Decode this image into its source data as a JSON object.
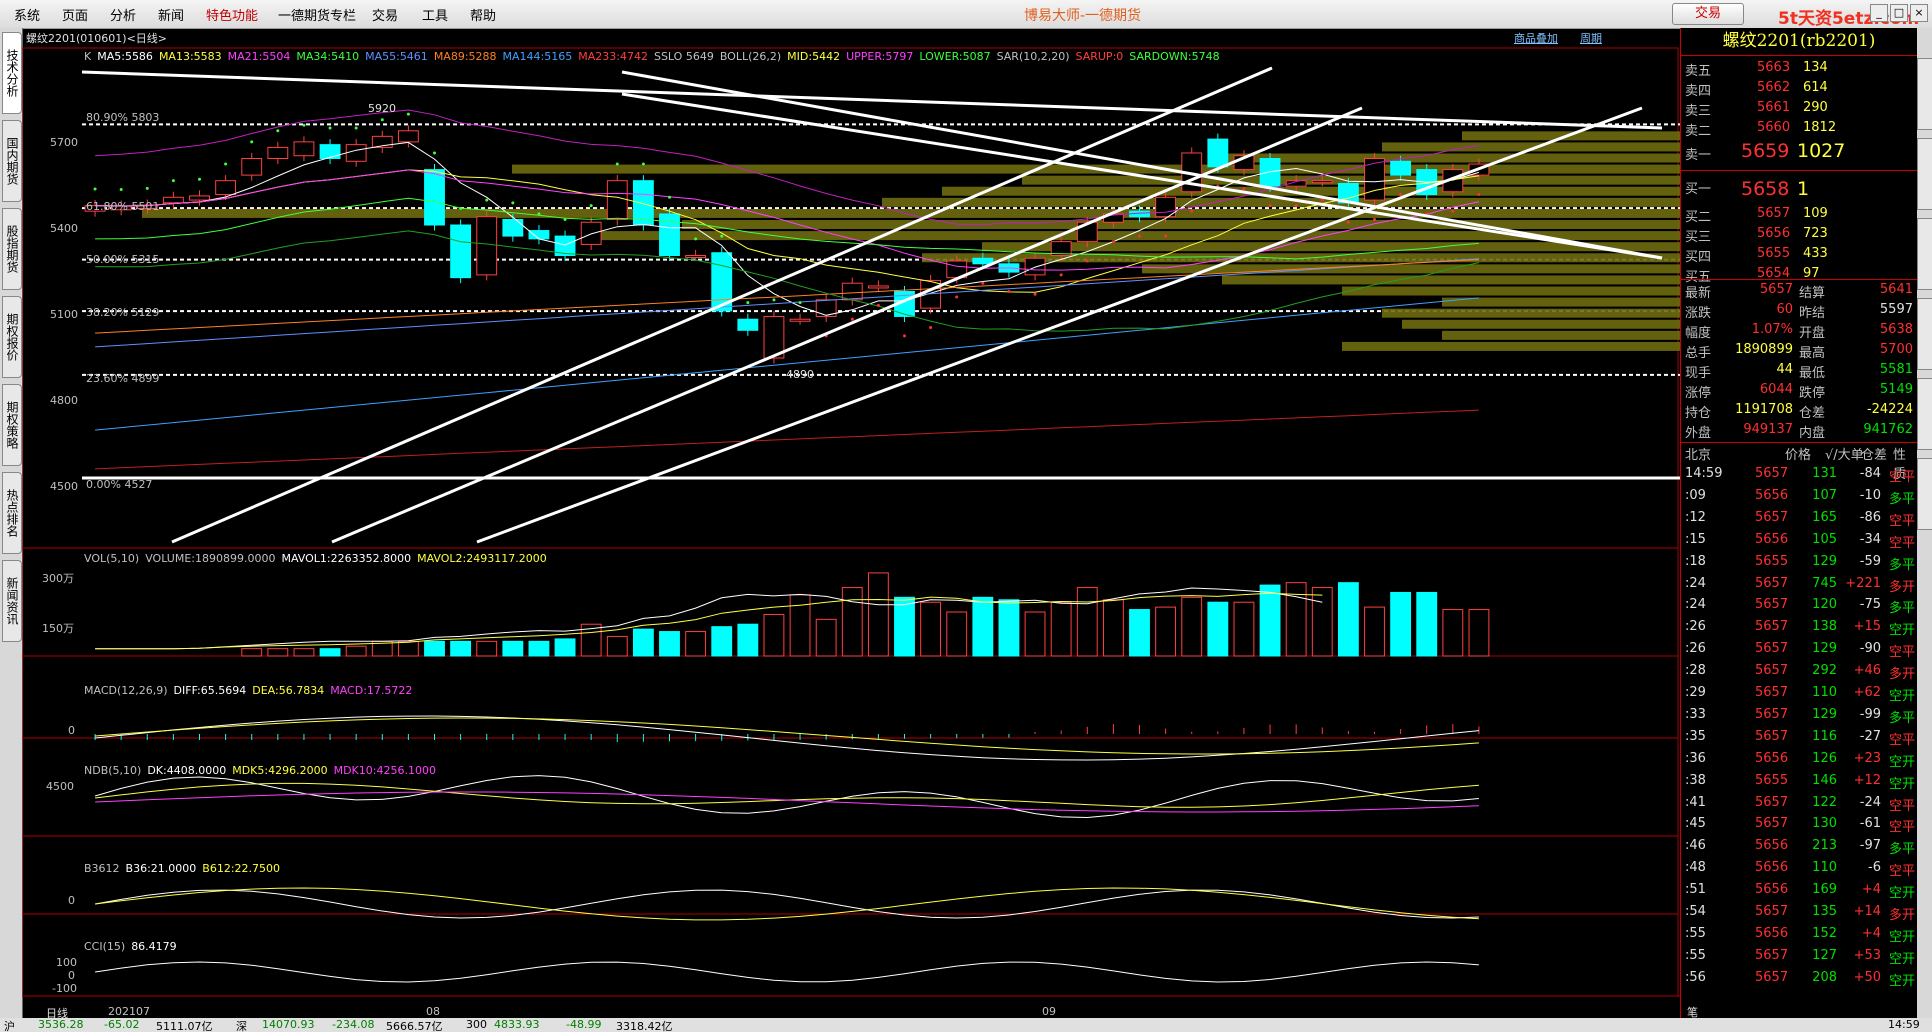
{
  "menu": {
    "items": [
      "系统",
      "页面",
      "分析",
      "新闻",
      "特色功能",
      "一德期货专栏",
      "交易",
      "工具",
      "帮助"
    ],
    "center_title": "博易大师-一德期货",
    "trade_button": "交易",
    "watermark": "5t天资5etz.com"
  },
  "left_tabs": [
    "技术分析",
    "国内期货",
    "股指期货",
    "期权报价",
    "期权策略",
    "热点排名",
    "新闻资讯"
  ],
  "chart_header": {
    "symbol": "螺纹2201(010601)<日线>",
    "links": [
      "商品叠加",
      "周期"
    ],
    "main_indicators": [
      {
        "text": "K",
        "color": "#c0c0c0"
      },
      {
        "text": "MA5:5586",
        "color": "#ffffff"
      },
      {
        "text": "MA13:5583",
        "color": "#ffff40"
      },
      {
        "text": "MA21:5504",
        "color": "#ff40ff"
      },
      {
        "text": "MA34:5410",
        "color": "#40ff40"
      },
      {
        "text": "MA55:5461",
        "color": "#6090ff"
      },
      {
        "text": "MA89:5288",
        "color": "#ff8020"
      },
      {
        "text": "MA144:5165",
        "color": "#40a0ff"
      },
      {
        "text": "MA233:4742",
        "color": "#ff4040"
      },
      {
        "text": "SSLO 5649",
        "color": "#c0c0c0"
      },
      {
        "text": "BOLL(26,2)",
        "color": "#c0c0c0"
      },
      {
        "text": "MID:5442",
        "color": "#ffff40"
      },
      {
        "text": "UPPER:5797",
        "color": "#ff40ff"
      },
      {
        "text": "LOWER:5087",
        "color": "#40ff40"
      },
      {
        "text": "SAR(10,2,20)",
        "color": "#c0c0c0"
      },
      {
        "text": "SARUP:0",
        "color": "#ff4040"
      },
      {
        "text": "SARDOWN:5748",
        "color": "#40ff40"
      }
    ]
  },
  "fib_levels": [
    {
      "label": "80.90% 5803"
    },
    {
      "label": "61.80% 5501"
    },
    {
      "label": "50.00% 5315"
    },
    {
      "label": "38.20% 5129"
    },
    {
      "label": "23.60% 4899"
    },
    {
      "label": "0.00% 4527"
    }
  ],
  "price_axis": [
    "5700",
    "5400",
    "5100",
    "4800",
    "4500"
  ],
  "price_marks": {
    "high": "5920",
    "low": "4890"
  },
  "vol_header": [
    {
      "text": "VOL(5,10)",
      "color": "#c0c0c0"
    },
    {
      "text": "VOLUME:1890899.0000",
      "color": "#c0c0c0"
    },
    {
      "text": "MAVOL1:2263352.8000",
      "color": "#ffffff"
    },
    {
      "text": "MAVOL2:2493117.2000",
      "color": "#ffff40"
    }
  ],
  "vol_axis": [
    "300万",
    "150万"
  ],
  "macd_header": [
    {
      "text": "MACD(12,26,9)",
      "color": "#c0c0c0"
    },
    {
      "text": "DIFF:65.5694",
      "color": "#ffffff"
    },
    {
      "text": "DEA:56.7834",
      "color": "#ffff40"
    },
    {
      "text": "MACD:17.5722",
      "color": "#ff40ff"
    }
  ],
  "macd_axis": [
    "0"
  ],
  "ndb_header": [
    {
      "text": "NDB(5,10)",
      "color": "#c0c0c0"
    },
    {
      "text": "DK:4408.0000",
      "color": "#ffffff"
    },
    {
      "text": "MDK5:4296.2000",
      "color": "#ffff40"
    },
    {
      "text": "MDK10:4256.1000",
      "color": "#ff40ff"
    }
  ],
  "ndb_axis": [
    "4500"
  ],
  "b3612_header": [
    {
      "text": "B3612",
      "color": "#c0c0c0"
    },
    {
      "text": "B36:21.0000",
      "color": "#ffffff"
    },
    {
      "text": "B612:22.7500",
      "color": "#ffff40"
    }
  ],
  "b3612_axis": [
    "0"
  ],
  "cci_header": [
    {
      "text": "CCI(15)",
      "color": "#c0c0c0"
    },
    {
      "text": "86.4179",
      "color": "#ffffff"
    }
  ],
  "cci_axis": [
    "100",
    "0",
    "-100"
  ],
  "time_axis": {
    "period_label": "日线",
    "labels": [
      "202107",
      "08",
      "09"
    ]
  },
  "quote": {
    "title": "螺纹2201(rb2201)",
    "asks": [
      {
        "label": "卖五",
        "price": "5663",
        "vol": "134"
      },
      {
        "label": "卖四",
        "price": "5662",
        "vol": "614"
      },
      {
        "label": "卖三",
        "price": "5661",
        "vol": "290"
      },
      {
        "label": "卖二",
        "price": "5660",
        "vol": "1812"
      },
      {
        "label": "卖一",
        "price": "5659",
        "vol": "1027"
      }
    ],
    "bids": [
      {
        "label": "买一",
        "price": "5658",
        "vol": "1"
      },
      {
        "label": "买二",
        "price": "5657",
        "vol": "109"
      },
      {
        "label": "买三",
        "price": "5656",
        "vol": "723"
      },
      {
        "label": "买四",
        "price": "5655",
        "vol": "433"
      },
      {
        "label": "买五",
        "price": "5654",
        "vol": "97"
      }
    ],
    "stats": [
      {
        "l1": "最新",
        "v1": "5657",
        "c1": "red",
        "l2": "结算",
        "v2": "5641",
        "c2": "red"
      },
      {
        "l1": "涨跌",
        "v1": "60",
        "c1": "red",
        "l2": "昨结",
        "v2": "5597",
        "c2": "white"
      },
      {
        "l1": "幅度",
        "v1": "1.07%",
        "c1": "red",
        "l2": "开盘",
        "v2": "5638",
        "c2": "red"
      },
      {
        "l1": "总手",
        "v1": "1890899",
        "c1": "yel",
        "l2": "最高",
        "v2": "5700",
        "c2": "red"
      },
      {
        "l1": "现手",
        "v1": "44",
        "c1": "yel",
        "l2": "最低",
        "v2": "5581",
        "c2": "green"
      },
      {
        "l1": "涨停",
        "v1": "6044",
        "c1": "red",
        "l2": "跌停",
        "v2": "5149",
        "c2": "green"
      },
      {
        "l1": "持仓",
        "v1": "1191708",
        "c1": "yel",
        "l2": "仓差",
        "v2": "-24224",
        "c2": "yel"
      },
      {
        "l1": "外盘",
        "v1": "949137",
        "c1": "red",
        "l2": "内盘",
        "v2": "941762",
        "c2": "green"
      }
    ],
    "tick_header": {
      "place": "北京",
      "price": "价格",
      "vol": "√/大单",
      "oi": "仓差",
      "nature": "性质"
    },
    "ticks": [
      {
        "t": "14:59",
        "p": "5657",
        "v": "131",
        "oi": "-84",
        "n": "空平",
        "nc": "red"
      },
      {
        "t": ":09",
        "p": "5656",
        "v": "107",
        "oi": "-10",
        "n": "多平",
        "nc": "green"
      },
      {
        "t": ":12",
        "p": "5657",
        "v": "165",
        "oi": "-86",
        "n": "空平",
        "nc": "red"
      },
      {
        "t": ":15",
        "p": "5656",
        "v": "105",
        "oi": "-34",
        "n": "空平",
        "nc": "red"
      },
      {
        "t": ":18",
        "p": "5655",
        "v": "129",
        "oi": "-59",
        "n": "多平",
        "nc": "green"
      },
      {
        "t": ":24",
        "p": "5657",
        "v": "745",
        "oi": "+221",
        "n": "多开",
        "nc": "red"
      },
      {
        "t": ":24",
        "p": "5657",
        "v": "120",
        "oi": "-75",
        "n": "多平",
        "nc": "green"
      },
      {
        "t": ":26",
        "p": "5657",
        "v": "138",
        "oi": "+15",
        "n": "空开",
        "nc": "green"
      },
      {
        "t": ":26",
        "p": "5657",
        "v": "129",
        "oi": "-90",
        "n": "空平",
        "nc": "red"
      },
      {
        "t": ":28",
        "p": "5657",
        "v": "292",
        "oi": "+46",
        "n": "多开",
        "nc": "red"
      },
      {
        "t": ":29",
        "p": "5657",
        "v": "110",
        "oi": "+62",
        "n": "空开",
        "nc": "green"
      },
      {
        "t": ":33",
        "p": "5657",
        "v": "129",
        "oi": "-99",
        "n": "多平",
        "nc": "green"
      },
      {
        "t": ":35",
        "p": "5657",
        "v": "116",
        "oi": "-27",
        "n": "空平",
        "nc": "red"
      },
      {
        "t": ":36",
        "p": "5656",
        "v": "126",
        "oi": "+23",
        "n": "空开",
        "nc": "green"
      },
      {
        "t": ":38",
        "p": "5655",
        "v": "146",
        "oi": "+12",
        "n": "空开",
        "nc": "green"
      },
      {
        "t": ":41",
        "p": "5657",
        "v": "122",
        "oi": "-24",
        "n": "空平",
        "nc": "red"
      },
      {
        "t": ":45",
        "p": "5657",
        "v": "130",
        "oi": "-61",
        "n": "空平",
        "nc": "red"
      },
      {
        "t": ":46",
        "p": "5656",
        "v": "213",
        "oi": "-97",
        "n": "多平",
        "nc": "green"
      },
      {
        "t": ":48",
        "p": "5656",
        "v": "110",
        "oi": "-6",
        "n": "空平",
        "nc": "red"
      },
      {
        "t": ":51",
        "p": "5656",
        "v": "169",
        "oi": "+4",
        "n": "空开",
        "nc": "green"
      },
      {
        "t": ":54",
        "p": "5657",
        "v": "135",
        "oi": "+14",
        "n": "多开",
        "nc": "red"
      },
      {
        "t": ":55",
        "p": "5656",
        "v": "152",
        "oi": "+4",
        "n": "空开",
        "nc": "green"
      },
      {
        "t": ":55",
        "p": "5657",
        "v": "127",
        "oi": "+53",
        "n": "空开",
        "nc": "green"
      },
      {
        "t": ":56",
        "p": "5657",
        "v": "208",
        "oi": "+50",
        "n": "空开",
        "nc": "green"
      }
    ],
    "bottom_tab": "笔"
  },
  "status_bar": {
    "items": [
      "沪",
      "3536.28",
      "-65.02",
      "5111.07亿",
      "深",
      "14070.93",
      "-234.08",
      "5666.57亿",
      "300",
      "4833.93",
      "-48.99",
      "3318.42亿"
    ],
    "right": "14:59"
  },
  "candles": [
    {
      "o": 5490,
      "c": 5510
    },
    {
      "o": 5495,
      "c": 5508
    },
    {
      "o": 5500,
      "c": 5512
    },
    {
      "o": 5520,
      "c": 5540
    },
    {
      "o": 5530,
      "c": 5545
    },
    {
      "o": 5550,
      "c": 5600
    },
    {
      "o": 5620,
      "c": 5680
    },
    {
      "o": 5680,
      "c": 5720
    },
    {
      "o": 5690,
      "c": 5740
    },
    {
      "o": 5730,
      "c": 5680
    },
    {
      "o": 5670,
      "c": 5730
    },
    {
      "o": 5720,
      "c": 5760
    },
    {
      "o": 5740,
      "c": 5780
    },
    {
      "o": 5640,
      "c": 5440
    },
    {
      "o": 5440,
      "c": 5250
    },
    {
      "o": 5260,
      "c": 5470
    },
    {
      "o": 5460,
      "c": 5400
    },
    {
      "o": 5420,
      "c": 5390
    },
    {
      "o": 5400,
      "c": 5330
    },
    {
      "o": 5370,
      "c": 5450
    },
    {
      "o": 5460,
      "c": 5600
    },
    {
      "o": 5600,
      "c": 5440
    },
    {
      "o": 5480,
      "c": 5330
    },
    {
      "o": 5330,
      "c": 5330
    },
    {
      "o": 5340,
      "c": 5130
    },
    {
      "o": 5100,
      "c": 5060
    },
    {
      "o": 4960,
      "c": 5110
    },
    {
      "o": 5100,
      "c": 5100
    },
    {
      "o": 5110,
      "c": 5170
    },
    {
      "o": 5170,
      "c": 5230
    },
    {
      "o": 5220,
      "c": 5220
    },
    {
      "o": 5200,
      "c": 5110
    },
    {
      "o": 5140,
      "c": 5240
    },
    {
      "o": 5250,
      "c": 5310
    },
    {
      "o": 5320,
      "c": 5300
    },
    {
      "o": 5300,
      "c": 5270
    },
    {
      "o": 5260,
      "c": 5320
    },
    {
      "o": 5330,
      "c": 5380
    },
    {
      "o": 5380,
      "c": 5450
    },
    {
      "o": 5450,
      "c": 5480
    },
    {
      "o": 5490,
      "c": 5470
    },
    {
      "o": 5470,
      "c": 5540
    },
    {
      "o": 5560,
      "c": 5700
    },
    {
      "o": 5750,
      "c": 5650
    },
    {
      "o": 5640,
      "c": 5690
    },
    {
      "o": 5680,
      "c": 5580
    },
    {
      "o": 5580,
      "c": 5600
    },
    {
      "o": 5600,
      "c": 5600
    },
    {
      "o": 5590,
      "c": 5520
    },
    {
      "o": 5530,
      "c": 5680
    },
    {
      "o": 5670,
      "c": 5620
    },
    {
      "o": 5640,
      "c": 5550
    },
    {
      "o": 5560,
      "c": 5640
    },
    {
      "o": 5620,
      "c": 5660
    }
  ],
  "volumes": [
    0.3,
    0.3,
    0.3,
    0.3,
    0.4,
    0.6,
    0.6,
    0.6,
    0.6,
    0.6,
    0.6,
    0.6,
    0.7,
    1.3,
    0.8,
    1.1,
    1.0,
    1.0,
    1.2,
    1.3,
    1.7,
    2.5,
    1.5,
    2.8,
    3.4,
    2.4,
    2.2,
    1.8,
    2.4,
    2.3,
    1.8,
    2.2,
    2.8,
    2.3,
    1.9,
    2.0,
    2.4,
    2.2,
    2.2,
    2.9,
    3.0,
    2.8,
    3.0,
    2.0,
    2.6,
    2.6,
    1.9,
    1.9
  ]
}
